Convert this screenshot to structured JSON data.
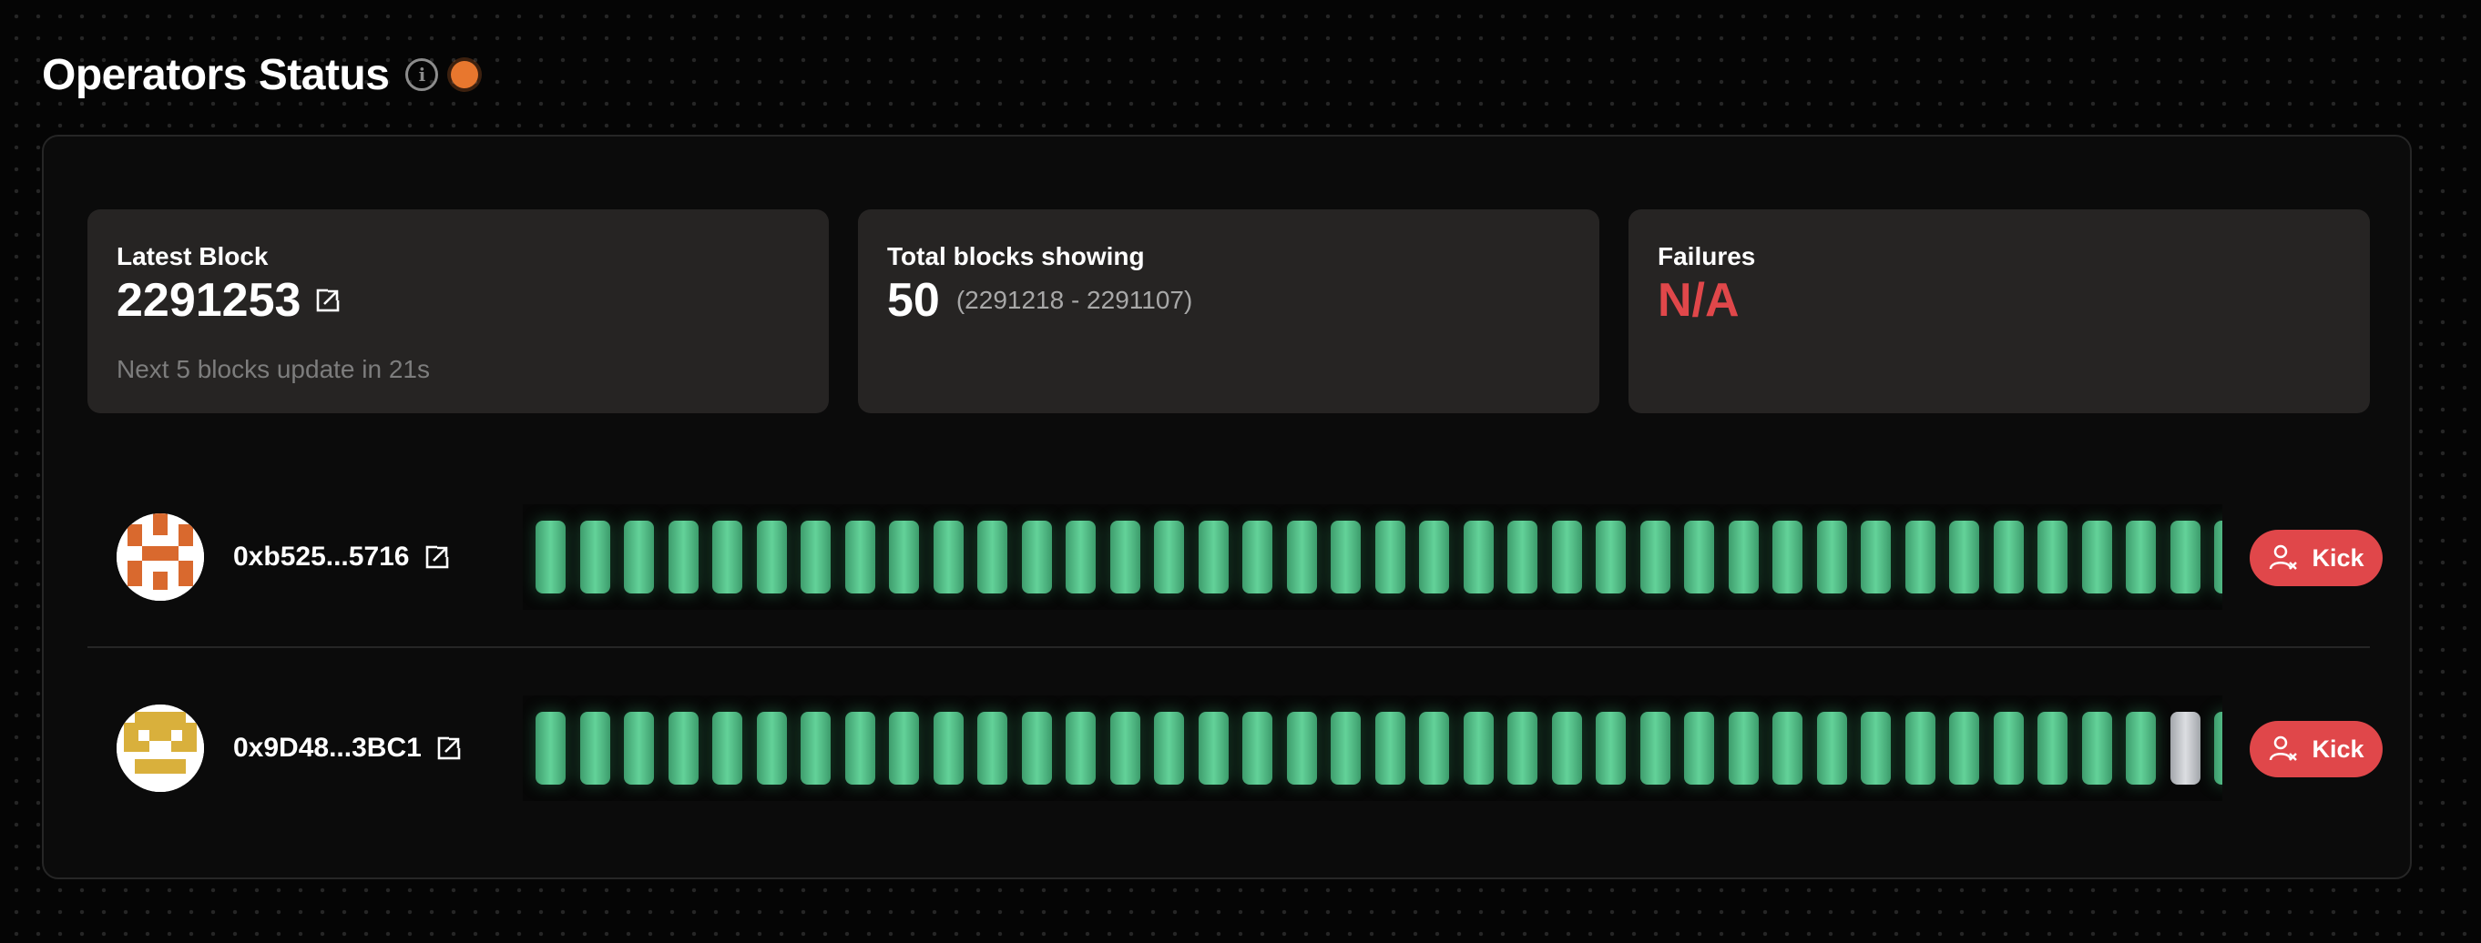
{
  "header": {
    "title": "Operators Status",
    "info_icon": "info-icon",
    "status_color": "#e8772e"
  },
  "cards": {
    "latest_block": {
      "label": "Latest Block",
      "value": "2291253",
      "subtext": "Next 5 blocks update in 21s"
    },
    "total_blocks": {
      "label": "Total blocks showing",
      "value": "50",
      "range": "(2291218 - 2291107)"
    },
    "failures": {
      "label": "Failures",
      "value": "N/A",
      "color": "#e0474a"
    }
  },
  "operators": [
    {
      "address": "0xb525...5716",
      "avatar_color": "#d9692e",
      "blocks": [
        "ok",
        "ok",
        "ok",
        "ok",
        "ok",
        "ok",
        "ok",
        "ok",
        "ok",
        "ok",
        "ok",
        "ok",
        "ok",
        "ok",
        "ok",
        "ok",
        "ok",
        "ok",
        "ok",
        "ok",
        "ok",
        "ok",
        "ok",
        "ok",
        "ok",
        "ok",
        "ok",
        "ok",
        "ok",
        "ok",
        "ok",
        "ok",
        "ok",
        "ok",
        "ok",
        "ok",
        "ok",
        "ok",
        "ok"
      ],
      "kick_label": "Kick"
    },
    {
      "address": "0x9D48...3BC1",
      "avatar_color": "#d9b03c",
      "blocks": [
        "ok",
        "ok",
        "ok",
        "ok",
        "ok",
        "ok",
        "ok",
        "ok",
        "ok",
        "ok",
        "ok",
        "ok",
        "ok",
        "ok",
        "ok",
        "ok",
        "ok",
        "ok",
        "ok",
        "ok",
        "ok",
        "ok",
        "ok",
        "ok",
        "ok",
        "ok",
        "ok",
        "ok",
        "ok",
        "ok",
        "ok",
        "ok",
        "ok",
        "ok",
        "ok",
        "ok",
        "ok",
        "pending",
        "ok",
        "ok"
      ],
      "kick_label": "Kick"
    }
  ],
  "colors": {
    "block_ok": "#5cc890",
    "block_pending": "#c9cbcf",
    "kick_button": "#e0474a"
  }
}
